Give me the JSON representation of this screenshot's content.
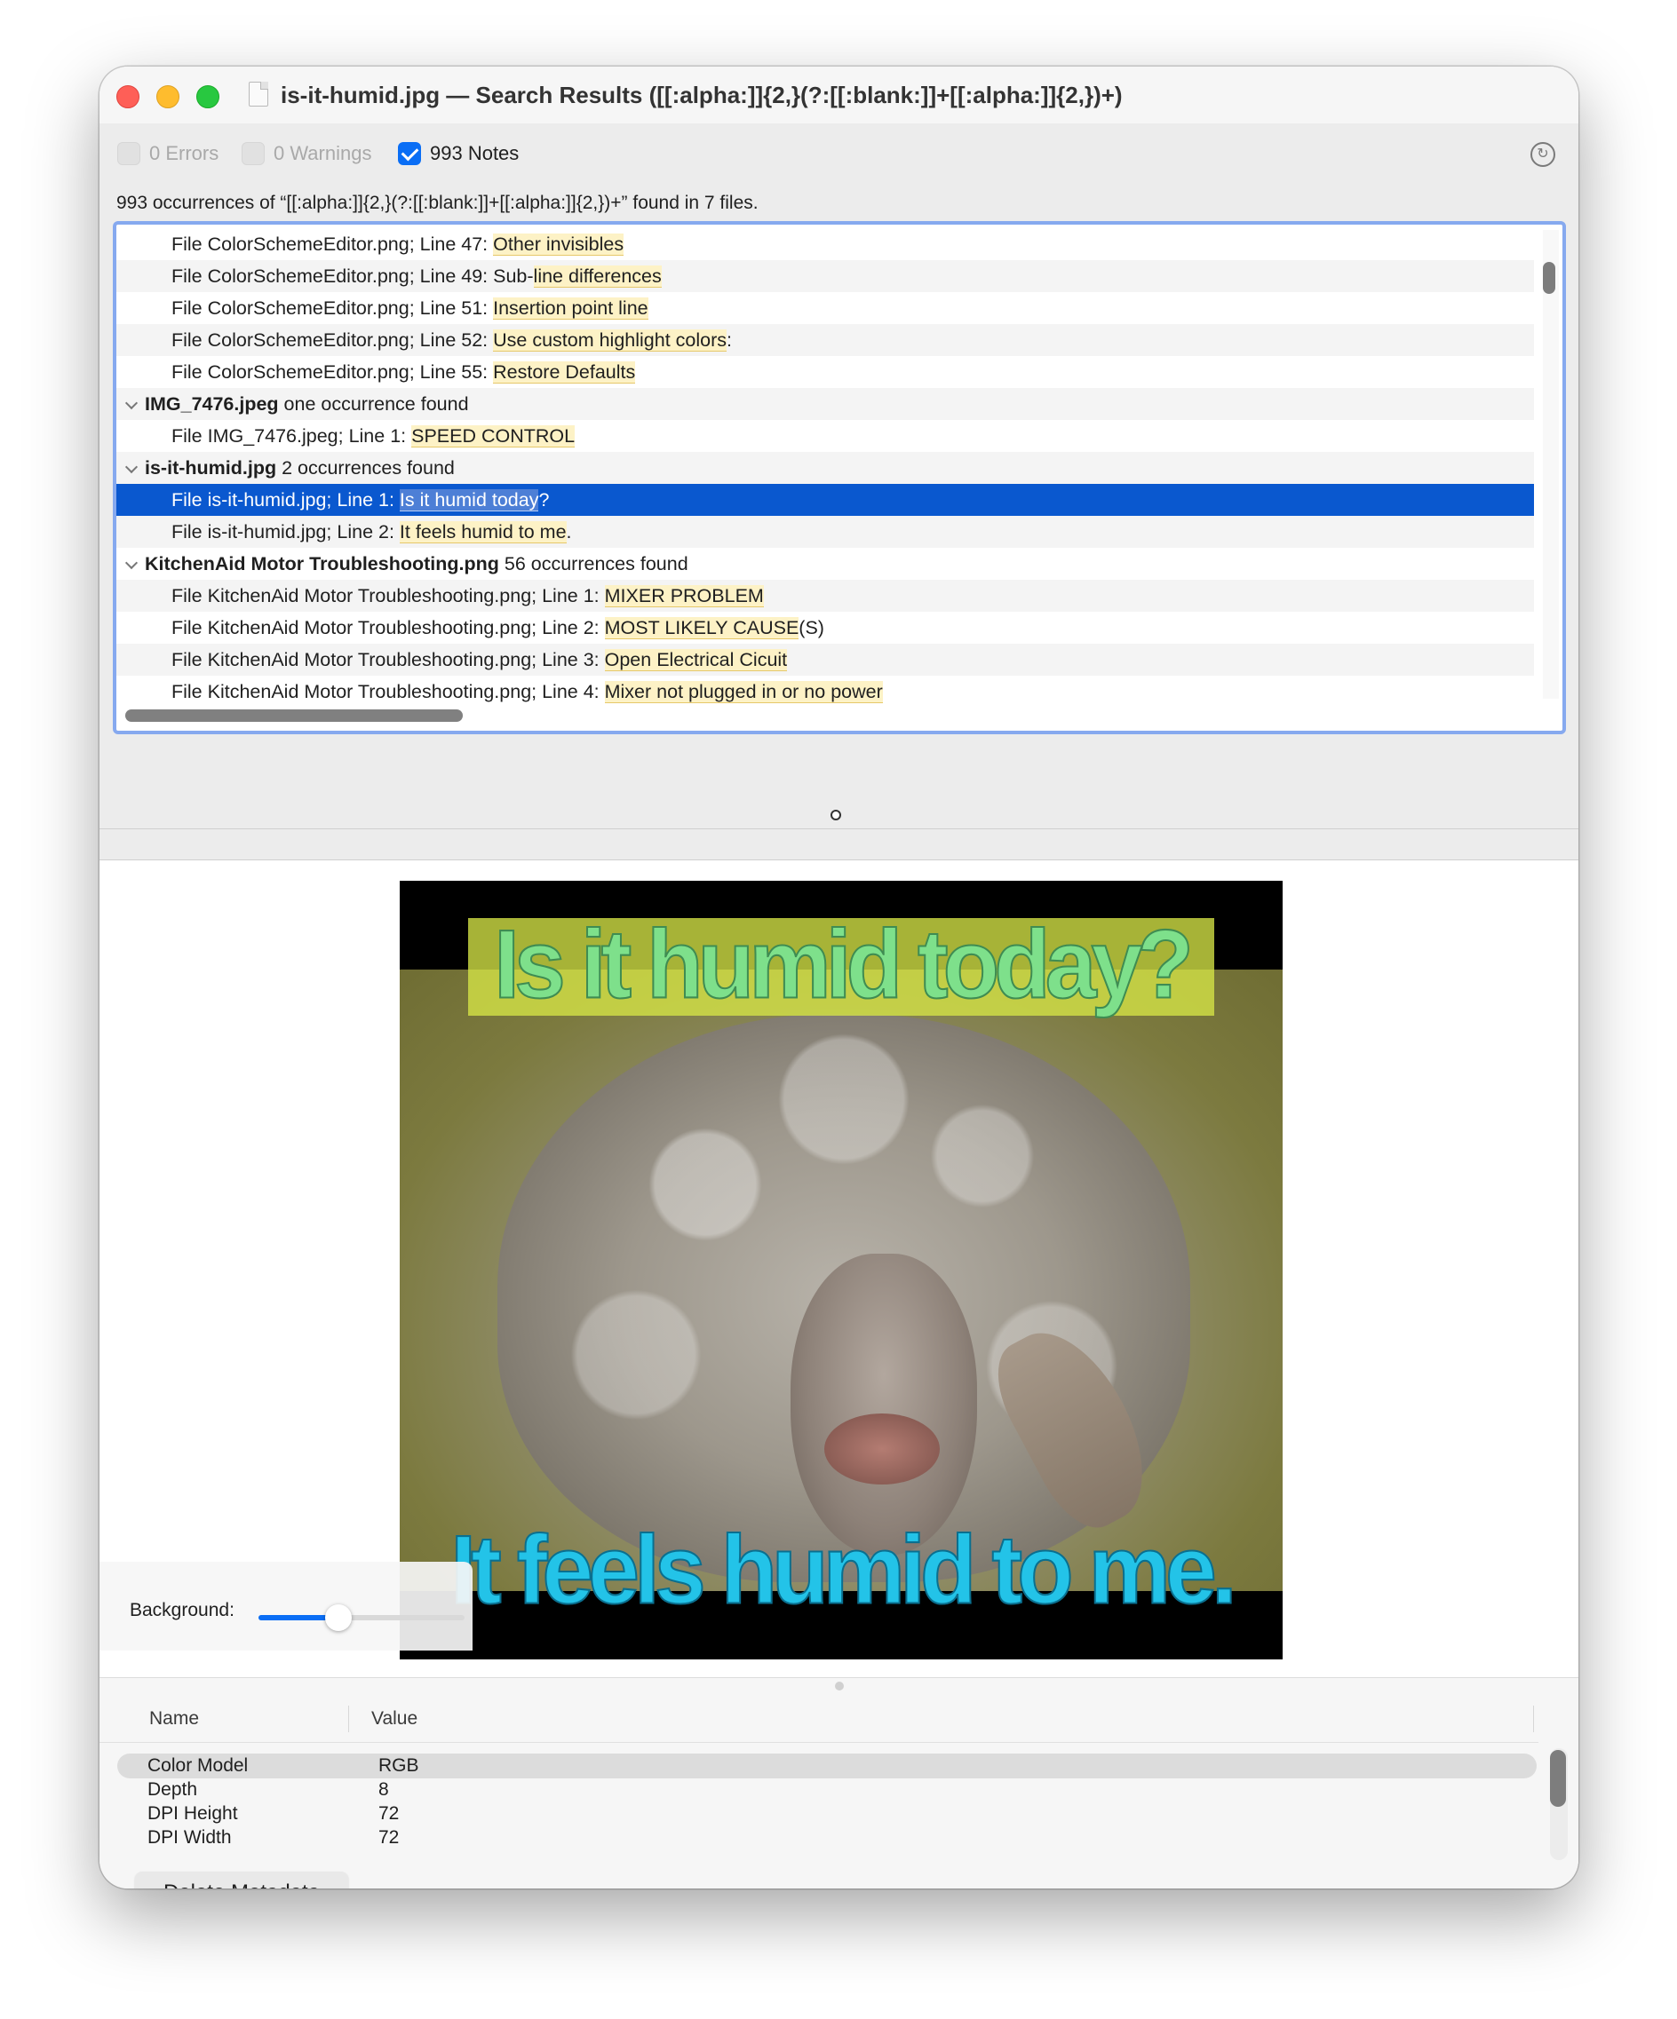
{
  "window": {
    "title": "is-it-humid.jpg — Search Results ([[:alpha:]]{2,}(?:[[:blank:]]+[[:alpha:]]{2,})+)"
  },
  "filters": {
    "errors_label": "0 Errors",
    "warnings_label": "0 Warnings",
    "notes_label": "993 Notes",
    "notes_checked": true
  },
  "summary": "993 occurrences of “[[:alpha:]]{2,}(?:[[:blank:]]+[[:alpha:]]{2,})+” found in 7 files.",
  "results": [
    {
      "kind": "item",
      "prefix": "File ColorSchemeEditor.png; Line 47: ",
      "match": "Other invisibles",
      "suffix": ""
    },
    {
      "kind": "item",
      "prefix": "File ColorSchemeEditor.png; Line 49: Sub-",
      "match": "line differences",
      "suffix": ""
    },
    {
      "kind": "item",
      "prefix": "File ColorSchemeEditor.png; Line 51: ",
      "match": "Insertion point line",
      "suffix": ""
    },
    {
      "kind": "item",
      "prefix": "File ColorSchemeEditor.png; Line 52: ",
      "match": "Use custom highlight colors",
      "suffix": ":"
    },
    {
      "kind": "item",
      "prefix": "File ColorSchemeEditor.png; Line 55: ",
      "match": "Restore Defaults",
      "suffix": ""
    },
    {
      "kind": "group",
      "file": "IMG_7476.jpeg",
      "count": " one occurrence found"
    },
    {
      "kind": "item",
      "prefix": "File IMG_7476.jpeg; Line 1: ",
      "match": "SPEED CONTROL",
      "suffix": ""
    },
    {
      "kind": "group",
      "file": "is-it-humid.jpg",
      "count": " 2 occurrences found"
    },
    {
      "kind": "item",
      "prefix": "File is-it-humid.jpg; Line 1: ",
      "match": "Is it humid today",
      "suffix": "?",
      "selected": true
    },
    {
      "kind": "item",
      "prefix": "File is-it-humid.jpg; Line 2: ",
      "match": "It feels humid to me",
      "suffix": "."
    },
    {
      "kind": "group",
      "file": "KitchenAid Motor Troubleshooting.png",
      "count": " 56 occurrences found"
    },
    {
      "kind": "item",
      "prefix": "File KitchenAid Motor Troubleshooting.png; Line 1: ",
      "match": "MIXER PROBLEM",
      "suffix": ""
    },
    {
      "kind": "item",
      "prefix": "File KitchenAid Motor Troubleshooting.png; Line 2: ",
      "match": "MOST LIKELY CAUSE",
      "suffix": "(S)"
    },
    {
      "kind": "item",
      "prefix": "File KitchenAid Motor Troubleshooting.png; Line 3: ",
      "match": "Open Electrical Cicuit",
      "suffix": ""
    },
    {
      "kind": "item",
      "prefix": "File KitchenAid Motor Troubleshooting.png; Line 4: ",
      "match": "Mixer not plugged in or no power",
      "suffix": ""
    }
  ],
  "preview": {
    "meme_top_text": "Is it humid today?",
    "meme_bottom_text": "It feels humid to me.",
    "background_label": "Background:",
    "background_level": 0.39
  },
  "metadata": {
    "col_name": "Name",
    "col_value": "Value",
    "rows": [
      {
        "name": "Color Model",
        "value": "RGB",
        "selected": true
      },
      {
        "name": "Depth",
        "value": "8"
      },
      {
        "name": "DPI Height",
        "value": "72"
      },
      {
        "name": "DPI Width",
        "value": "72"
      }
    ],
    "delete_label": "Delete Metadata"
  },
  "icons": {
    "document": "document-icon",
    "refresh": "refresh-icon",
    "disclosure": "chevron-down-icon"
  },
  "colors": {
    "accent": "#0a6ef5",
    "selection": "#0a58cf",
    "match_highlight": "#fdf2c6",
    "close": "#fe5f57",
    "minimize": "#febc2e",
    "zoom": "#28c840"
  }
}
